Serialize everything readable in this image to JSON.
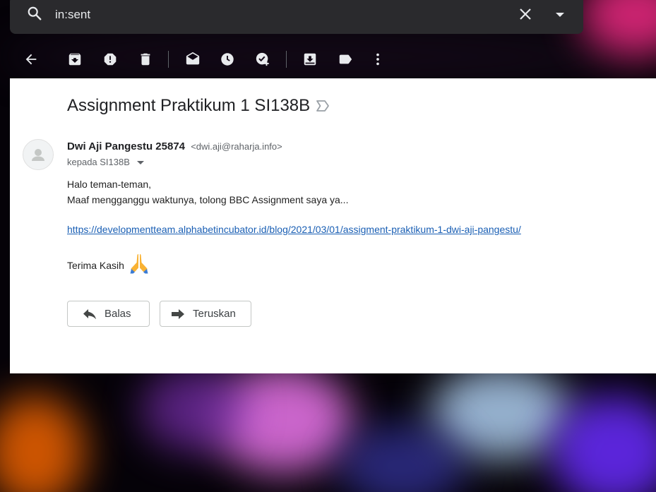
{
  "search": {
    "query": "in:sent"
  },
  "toolbar": {
    "icons": [
      "back-arrow-icon",
      "archive-icon",
      "report-spam-icon",
      "delete-icon",
      "mark-unread-icon",
      "snooze-icon",
      "add-to-tasks-icon",
      "move-to-icon",
      "labels-icon",
      "more-vert-icon"
    ]
  },
  "email": {
    "subject": "Assignment Praktikum 1 SI138B",
    "sender_name": "Dwi Aji Pangestu 25874",
    "sender_email": "<dwi.aji@raharja.info>",
    "recipient": "kepada SI138B",
    "body": {
      "greeting": "Halo teman-teman,",
      "line2": "Maaf mengganggu waktunya, tolong BBC Assignment saya ya...",
      "link": "https://developmentteam.alphabetincubator.id/blog/2021/03/01/assigment-praktikum-1-dwi-aji-pangestu/",
      "closing": "Terima Kasih"
    }
  },
  "actions": {
    "reply_label": "Balas",
    "forward_label": "Teruskan"
  },
  "colors": {
    "link": "#1a5fb4",
    "toolbar_icons": "#e8eaed",
    "search_bg": "#2a2a2d"
  }
}
